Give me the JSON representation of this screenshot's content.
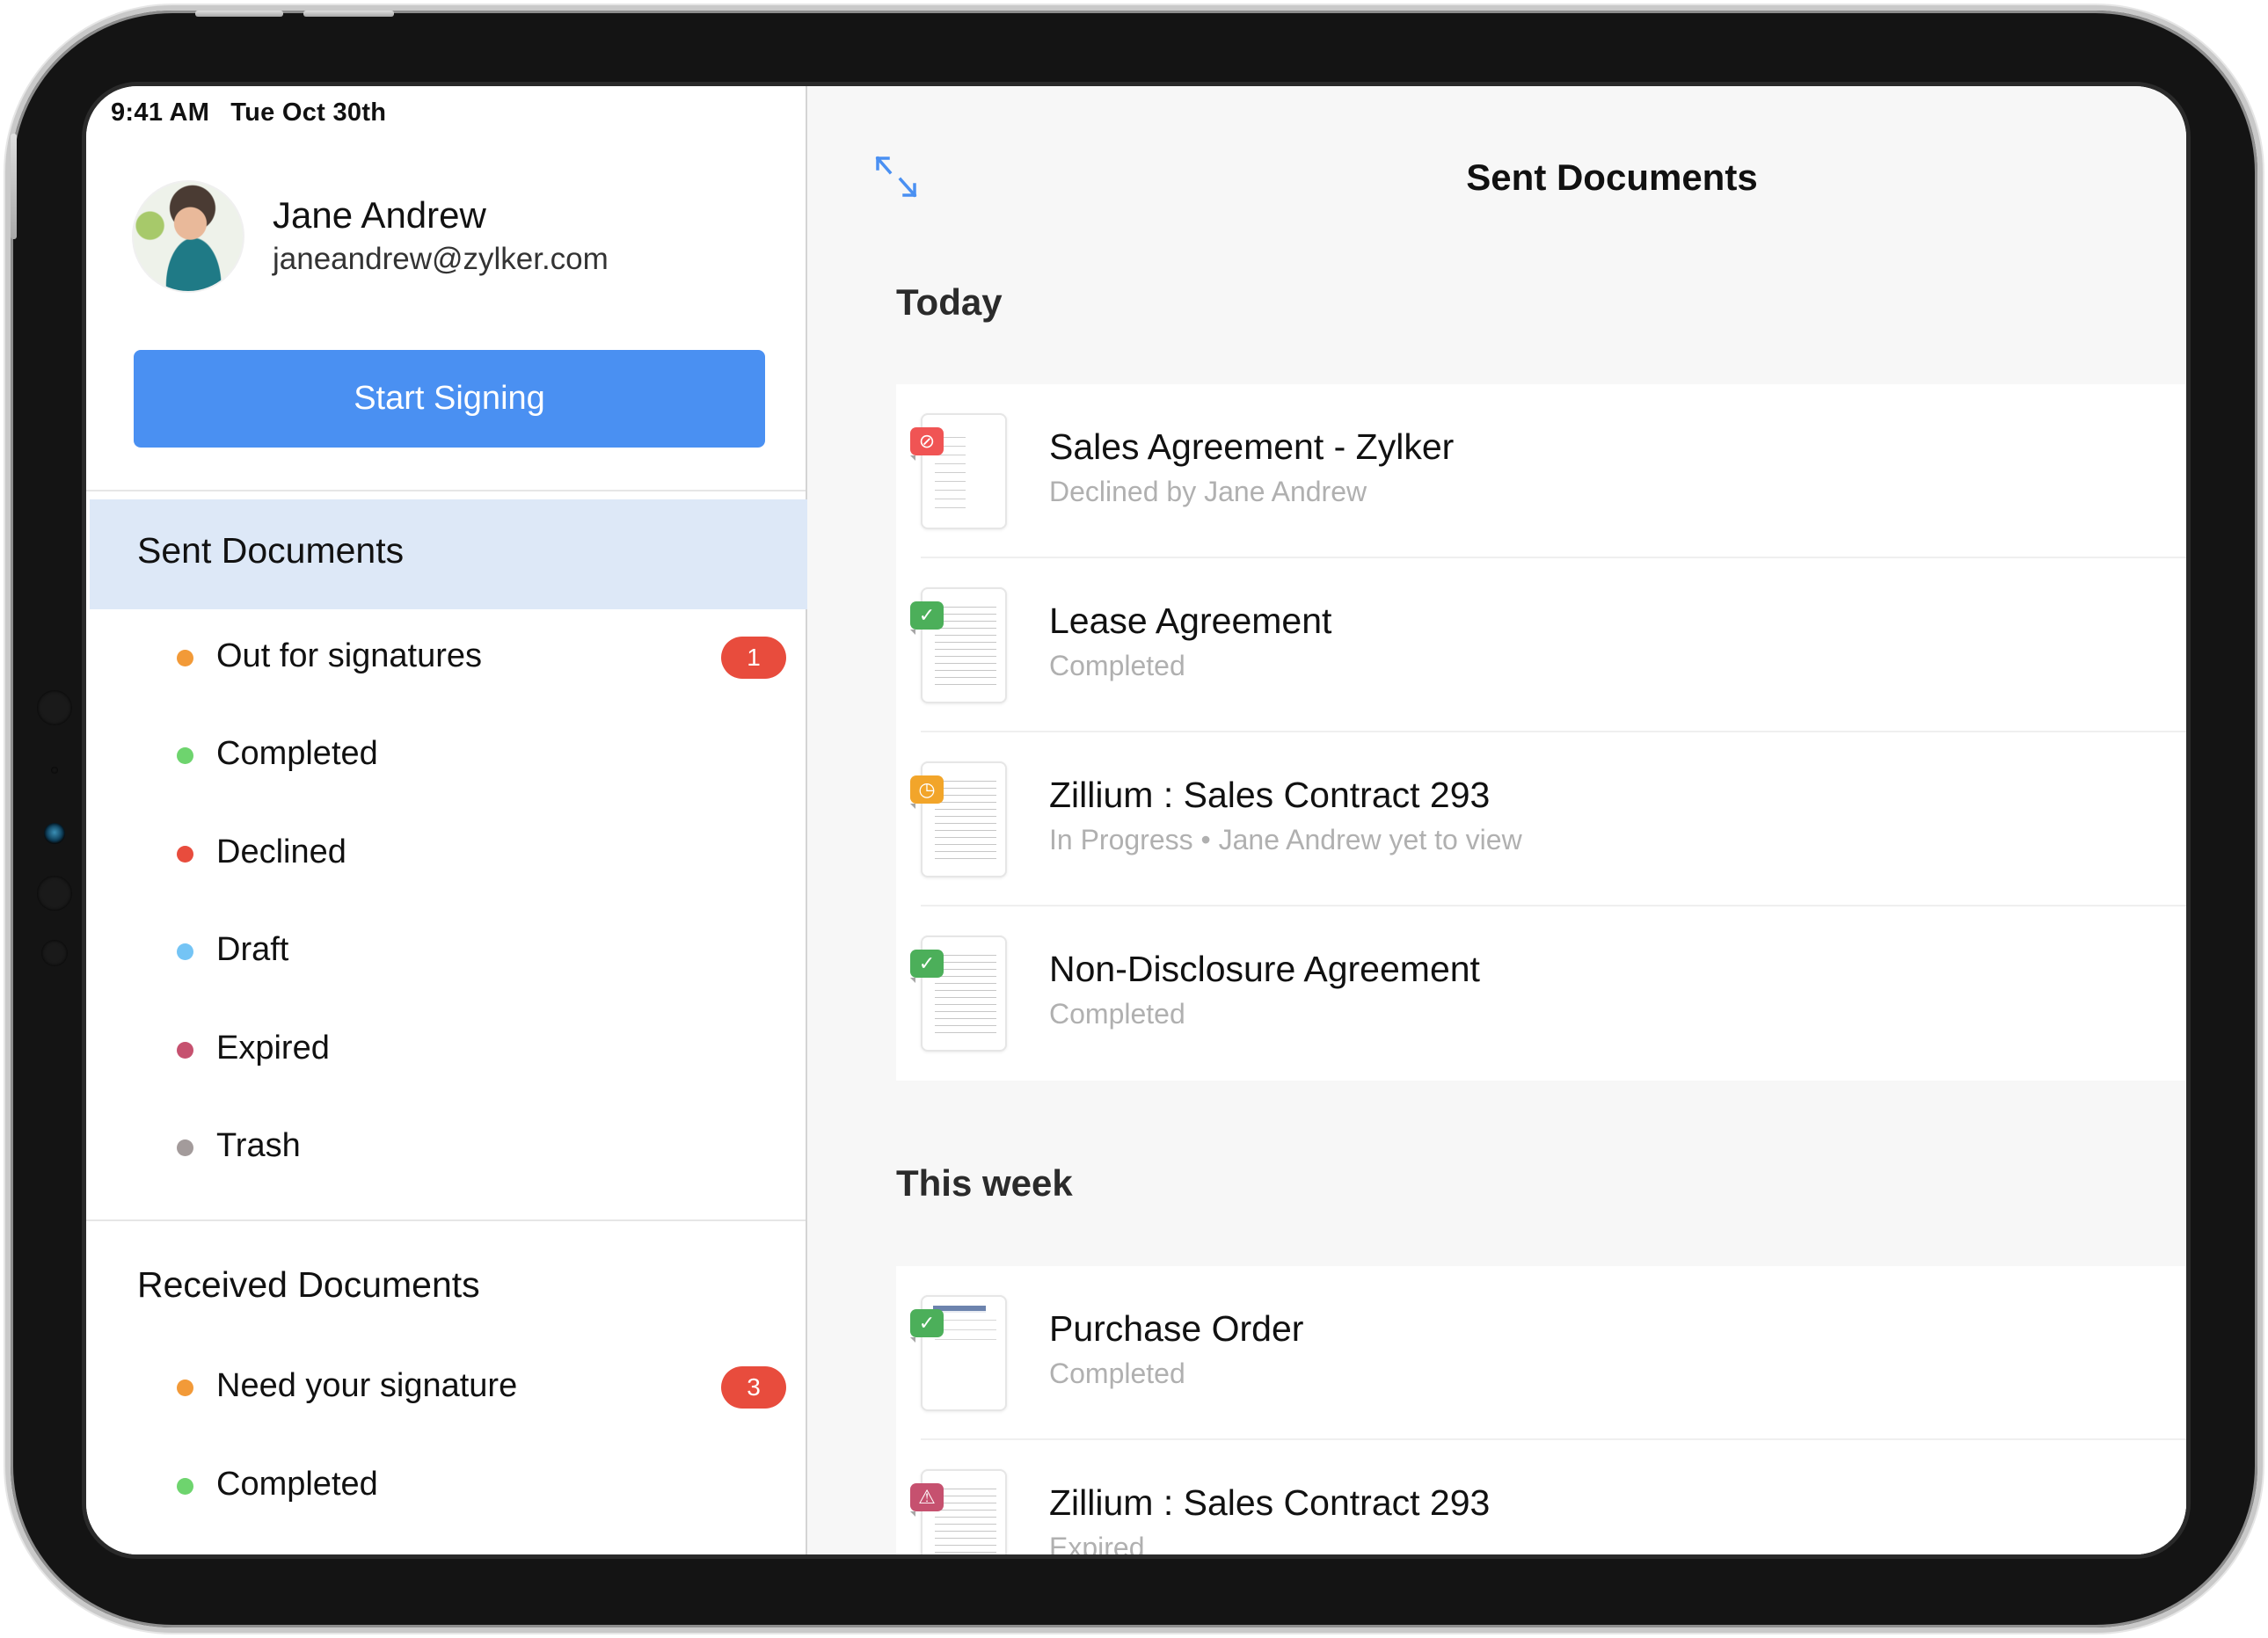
{
  "status_bar": {
    "time": "9:41 AM",
    "date": "Tue Oct 30th"
  },
  "profile": {
    "name": "Jane Andrew",
    "email": "janeandrew@zylker.com",
    "avatar_icon": "user-avatar-photo"
  },
  "sidebar": {
    "start_button": "Start Signing",
    "sent_section": {
      "title": "Sent Documents",
      "selected": true,
      "items": [
        {
          "label": "Out for signatures",
          "dot_color": "#f29a38",
          "badge": "1"
        },
        {
          "label": "Completed",
          "dot_color": "#6ed46e",
          "badge": null
        },
        {
          "label": "Declined",
          "dot_color": "#e84c3d",
          "badge": null
        },
        {
          "label": "Draft",
          "dot_color": "#74c4f5",
          "badge": null
        },
        {
          "label": "Expired",
          "dot_color": "#c6516f",
          "badge": null
        },
        {
          "label": "Trash",
          "dot_color": "#a39b9b",
          "badge": null
        }
      ]
    },
    "received_section": {
      "title": "Received Documents",
      "items": [
        {
          "label": "Need your signature",
          "dot_color": "#f29a38",
          "badge": "3"
        },
        {
          "label": "Completed",
          "dot_color": "#6ed46e",
          "badge": null
        }
      ]
    }
  },
  "main": {
    "title": "Sent Documents",
    "expand_icon": "expand-arrows-icon",
    "groups": [
      {
        "title": "Today",
        "documents": [
          {
            "title": "Sales Agreement - Zylker",
            "subtitle": "Declined by Jane Andrew",
            "status": "declined",
            "badge_color": "#f05454",
            "badge_glyph": "⊘"
          },
          {
            "title": "Lease Agreement",
            "subtitle": "Completed",
            "status": "completed",
            "badge_color": "#4caf5a",
            "badge_glyph": "✓"
          },
          {
            "title": "Zillium : Sales Contract 293",
            "subtitle": "In Progress • Jane Andrew yet to view",
            "status": "in-progress",
            "badge_color": "#f2a52a",
            "badge_glyph": "◷"
          },
          {
            "title": "Non-Disclosure Agreement",
            "subtitle": "Completed",
            "status": "completed",
            "badge_color": "#4caf5a",
            "badge_glyph": "✓"
          }
        ]
      },
      {
        "title": "This week",
        "documents": [
          {
            "title": "Purchase Order",
            "subtitle": "Completed",
            "status": "completed",
            "badge_color": "#4caf5a",
            "badge_glyph": "✓"
          },
          {
            "title": "Zillium : Sales Contract 293",
            "subtitle": "Expired",
            "status": "expired",
            "badge_color": "#c6516f",
            "badge_glyph": "⚠"
          }
        ]
      }
    ]
  },
  "colors": {
    "accent": "#4a90f2",
    "selected_bg": "#dde8f7",
    "badge_red": "#e84c3d"
  }
}
